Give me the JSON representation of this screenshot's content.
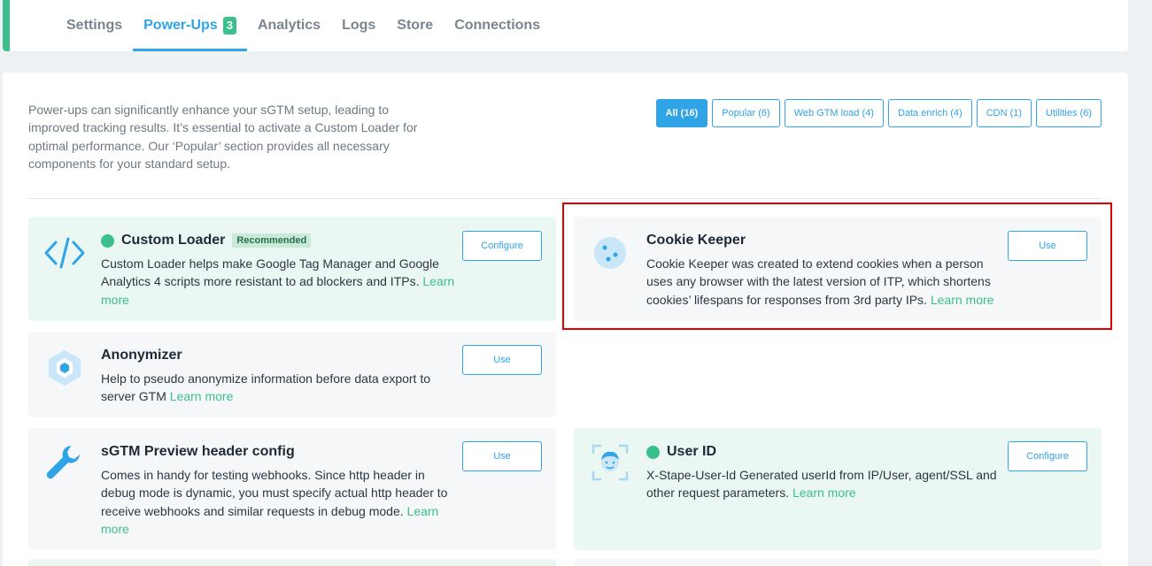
{
  "nav": {
    "tabs": [
      {
        "label": "Settings"
      },
      {
        "label": "Power-Ups",
        "badge": "3"
      },
      {
        "label": "Analytics"
      },
      {
        "label": "Logs"
      },
      {
        "label": "Store"
      },
      {
        "label": "Connections"
      }
    ]
  },
  "intro": "Power-ups can significantly enhance your sGTM setup, leading to improved tracking results. It’s essential to activate a Custom Loader for optimal performance. Our ‘Popular’ section provides all necessary components for your standard setup.",
  "filters": [
    {
      "label": "All (16)"
    },
    {
      "label": "Popular (6)"
    },
    {
      "label": "Web GTM load (4)"
    },
    {
      "label": "Data enrich (4)"
    },
    {
      "label": "CDN (1)"
    },
    {
      "label": "Utilities (6)"
    }
  ],
  "cards": {
    "custom_loader": {
      "title": "Custom Loader",
      "badge": "Recommended",
      "desc": "Custom Loader helps make Google Tag Manager and Google Analytics 4 scripts more resistant to ad blockers and ITPs.",
      "link": "Learn more",
      "action": "Configure",
      "icon": "code-icon"
    },
    "cookie_keeper": {
      "title": "Cookie Keeper",
      "desc": "Cookie Keeper was created to extend cookies when a person uses any browser with the latest version of ITP, which shortens cookies’ lifespans for responses from 3rd party IPs.",
      "link": "Learn more",
      "action": "Use",
      "icon": "cookie-icon"
    },
    "anonymizer": {
      "title": "Anonymizer",
      "desc": "Help to pseudo anonymize information before data export to server GTM",
      "link": "Learn more",
      "action": "Use",
      "icon": "hexagon-icon"
    },
    "preview_header": {
      "title": "sGTM Preview header config",
      "desc": "Comes in handy for testing webhooks. Since http header in debug mode is dynamic, you must specify actual http header to receive webhooks and similar requests in debug mode.",
      "link": "Learn more",
      "action": "Use",
      "icon": "wrench-icon"
    },
    "user_id": {
      "title": "User ID",
      "desc": "X-Stape-User-Id Generated userId from IP/User, agent/SSL and other request parameters.",
      "link": "Learn more",
      "action": "Configure",
      "icon": "face-scan-icon"
    }
  },
  "colors": {
    "accent": "#2fa4e7",
    "green": "#3bbf8c",
    "highlight": "#e00000"
  }
}
